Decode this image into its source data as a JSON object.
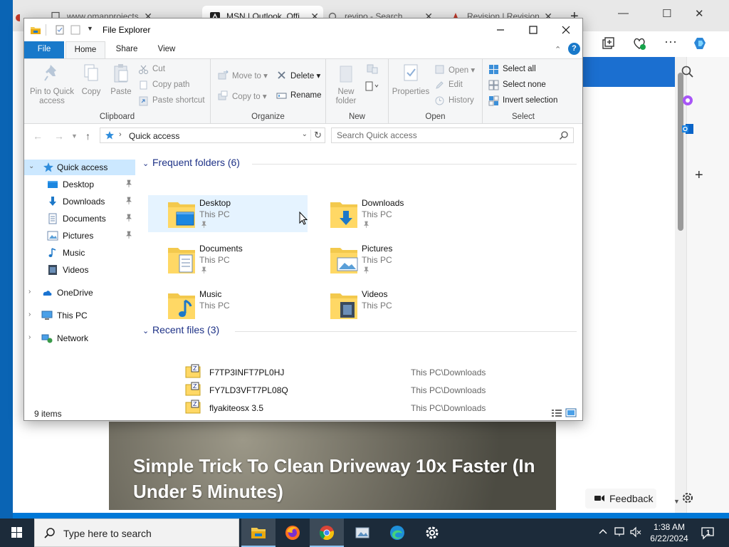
{
  "browser": {
    "tabs": [
      {
        "label": "www.omanprojects"
      },
      {
        "label": "MSN | Outlook, Offi"
      },
      {
        "label": "revipo - Search"
      },
      {
        "label": "Revision | Revision"
      }
    ],
    "headline": "Simple Trick To Clean Driveway 10x Faster (In Under 5 Minutes)",
    "feedback_label": "Feedback"
  },
  "explorer": {
    "title": "File Explorer",
    "ribbon_tabs": {
      "file": "File",
      "home": "Home",
      "share": "Share",
      "view": "View"
    },
    "clipboard": {
      "label": "Clipboard",
      "pin": "Pin to Quick access",
      "copy": "Copy",
      "paste": "Paste",
      "cut": "Cut",
      "copy_path": "Copy path",
      "paste_shortcut": "Paste shortcut"
    },
    "organize": {
      "label": "Organize",
      "move_to": "Move to",
      "copy_to": "Copy to",
      "delete": "Delete",
      "rename": "Rename"
    },
    "new_group": {
      "label": "New",
      "new_folder": "New folder"
    },
    "open_group": {
      "label": "Open",
      "properties": "Properties",
      "open": "Open",
      "edit": "Edit",
      "history": "History"
    },
    "select_group": {
      "label": "Select",
      "select_all": "Select all",
      "select_none": "Select none",
      "invert": "Invert selection"
    },
    "address": "Quick access",
    "search_placeholder": "Search Quick access",
    "nav": {
      "quick_access": "Quick access",
      "desktop": "Desktop",
      "downloads": "Downloads",
      "documents": "Documents",
      "pictures": "Pictures",
      "music": "Music",
      "videos": "Videos",
      "onedrive": "OneDrive",
      "this_pc": "This PC",
      "network": "Network"
    },
    "frequent_header": "Frequent folders (6)",
    "folders": [
      {
        "name": "Desktop",
        "location": "This PC"
      },
      {
        "name": "Downloads",
        "location": "This PC"
      },
      {
        "name": "Documents",
        "location": "This PC"
      },
      {
        "name": "Pictures",
        "location": "This PC"
      },
      {
        "name": "Music",
        "location": "This PC"
      },
      {
        "name": "Videos",
        "location": "This PC"
      }
    ],
    "recent_header": "Recent files (3)",
    "recent_files": [
      {
        "name": "F7TP3INFT7PL0HJ",
        "location": "This PC\\Downloads"
      },
      {
        "name": "FY7LD3VFT7PL08Q",
        "location": "This PC\\Downloads"
      },
      {
        "name": "flyakiteosx 3.5",
        "location": "This PC\\Downloads"
      }
    ],
    "status": "9 items"
  },
  "taskbar": {
    "search_text": "Type here to search",
    "time": "1:38 AM",
    "date": "6/22/2024",
    "notification_count": "1"
  },
  "colors": {
    "accent": "#1979ca",
    "taskbar": "#1c2b3a",
    "selection": "#cce8ff",
    "group_header": "#1e3287"
  }
}
